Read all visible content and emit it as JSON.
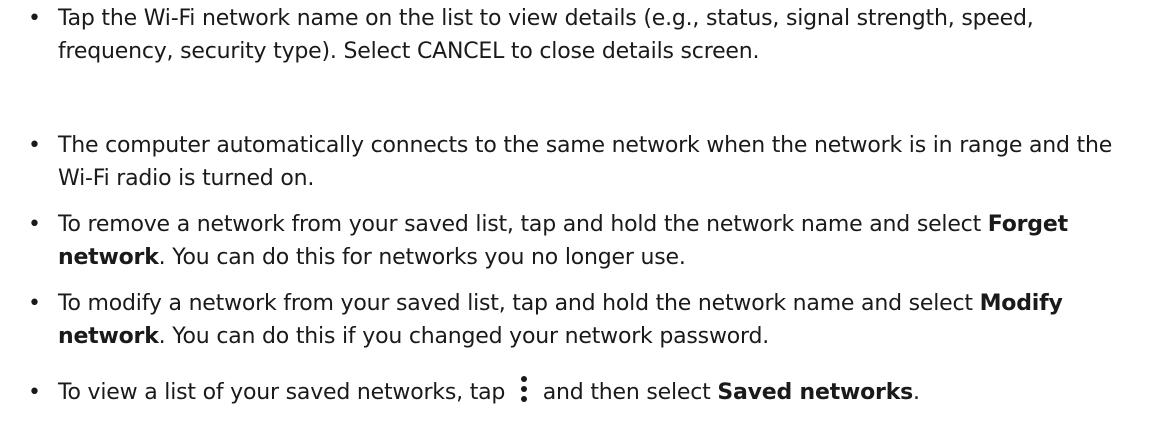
{
  "bullets": [
    {
      "marker": "•",
      "text": "Tap the Wi-Fi network name on the list to view details (e.g., status, signal strength, speed, frequency, security type). Select CANCEL to close details screen."
    },
    {
      "marker": "•",
      "text": "The computer automatically connects to the same network when the network is in range and the Wi-Fi radio is turned on."
    },
    {
      "marker": "•",
      "pre": "To remove a network from your saved list, tap and hold the network name and select ",
      "bold": "Forget network",
      "post": ". You can do this for networks you no longer use."
    },
    {
      "marker": "•",
      "pre": "To modify a network from your saved list, tap and hold the network name and select ",
      "bold": "Modify network",
      "post": ". You can do this if you changed your network password."
    },
    {
      "marker": "•",
      "pre": "To view a list of your saved networks, tap ",
      "icon": "overflow-menu-icon",
      "mid": " and then select ",
      "bold": "Saved networks",
      "post": "."
    }
  ]
}
